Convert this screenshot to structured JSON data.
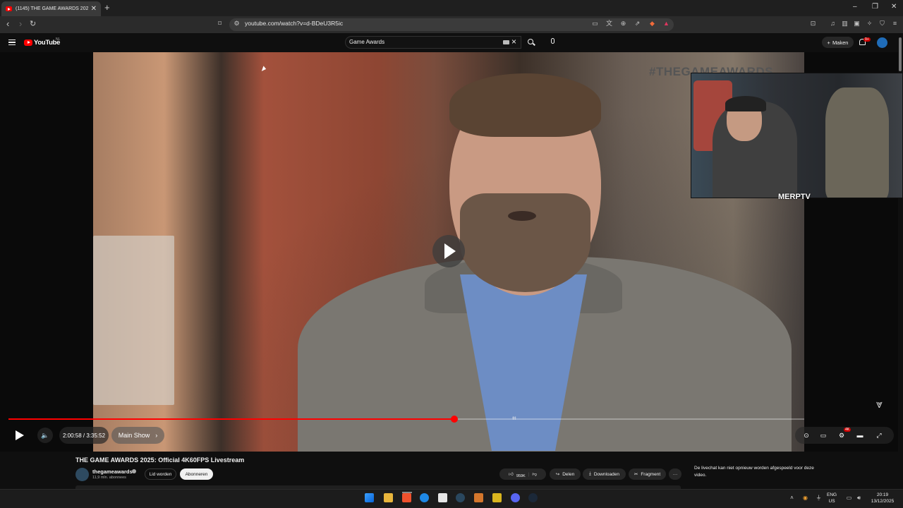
{
  "browser": {
    "tab_title": "(1145) THE GAME AWARDS 2025:",
    "url": "youtube.com/watch?v=d-BDeU3R5ic",
    "win_min": "–",
    "win_max": "❐",
    "win_close": "✕",
    "new_tab": "+",
    "tab_close": "✕"
  },
  "header": {
    "logo": "YouTube",
    "region": "NL",
    "search_value": "Game Awards",
    "create_label": "Maken",
    "notif_count": "9+"
  },
  "player": {
    "hashtag": "#THEGAMEAWARDS",
    "streamer_name": "MERPTV",
    "time": "2:00:58 / 3:35:52",
    "chapter": "Main Show",
    "chapter_chevron": "›",
    "quality_badge": "4K",
    "progress": 0.56
  },
  "video": {
    "title": "THE GAME AWARDS 2025: Official 4K60FPS Livestream",
    "channel": "thegameawards",
    "subscribers": "11,9 mln. abonnees",
    "join": "Lid worden",
    "subscribe": "Abonneren",
    "likes": "959K",
    "share": "Delen",
    "download": "Downloaden",
    "clip": "Fragment",
    "more": "···",
    "chat_note": "De livechat kan niet opnieuw worden afgespeeld voor deze video."
  },
  "taskbar": {
    "lang": "ENG",
    "locale": "US",
    "time": "20:19",
    "date": "13/12/2025"
  },
  "colors": {
    "accent": "#ff0000",
    "background": "#0f0f0f",
    "chip": "#272727"
  }
}
